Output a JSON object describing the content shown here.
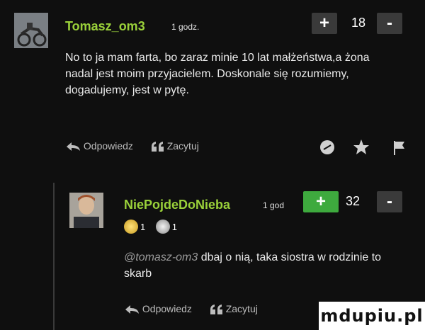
{
  "comments": [
    {
      "username": "Tomasz_om3",
      "time": "1 godz.",
      "votes": {
        "plus": "+",
        "count": "18",
        "minus": "-"
      },
      "text": "No to ja mam farta, bo zaraz minie 10 lat małżeństwa,a żona nadal jest moim przyjacielem. Doskonale się rozumiemy, dogadujemy, jest w pytę.",
      "actions": {
        "reply": "Odpowiedz",
        "quote": "Zacytuj"
      },
      "icons": [
        "comment-icon",
        "star-icon",
        "flag-icon"
      ]
    },
    {
      "username": "NiePojdeDoNieba",
      "time": "1 god",
      "votes": {
        "plus": "+",
        "count": "32",
        "minus": "-"
      },
      "badges": [
        {
          "icon": "gold-badge-icon",
          "count": "1"
        },
        {
          "icon": "silver-badge-icon",
          "count": "1"
        }
      ],
      "mention": "@tomasz-om3",
      "text": " dbaj o nią, taka siostra w rodzinie to skarb",
      "actions": {
        "reply": "Odpowiedz",
        "quote": "Zacytuj"
      },
      "icons": [
        "comment-icon",
        "star-icon"
      ]
    }
  ],
  "watermark": "mdupiu.pl",
  "colors": {
    "username": "#9ad13a",
    "upvote_active": "#3eaa3e",
    "background": "#0f0f0f"
  }
}
